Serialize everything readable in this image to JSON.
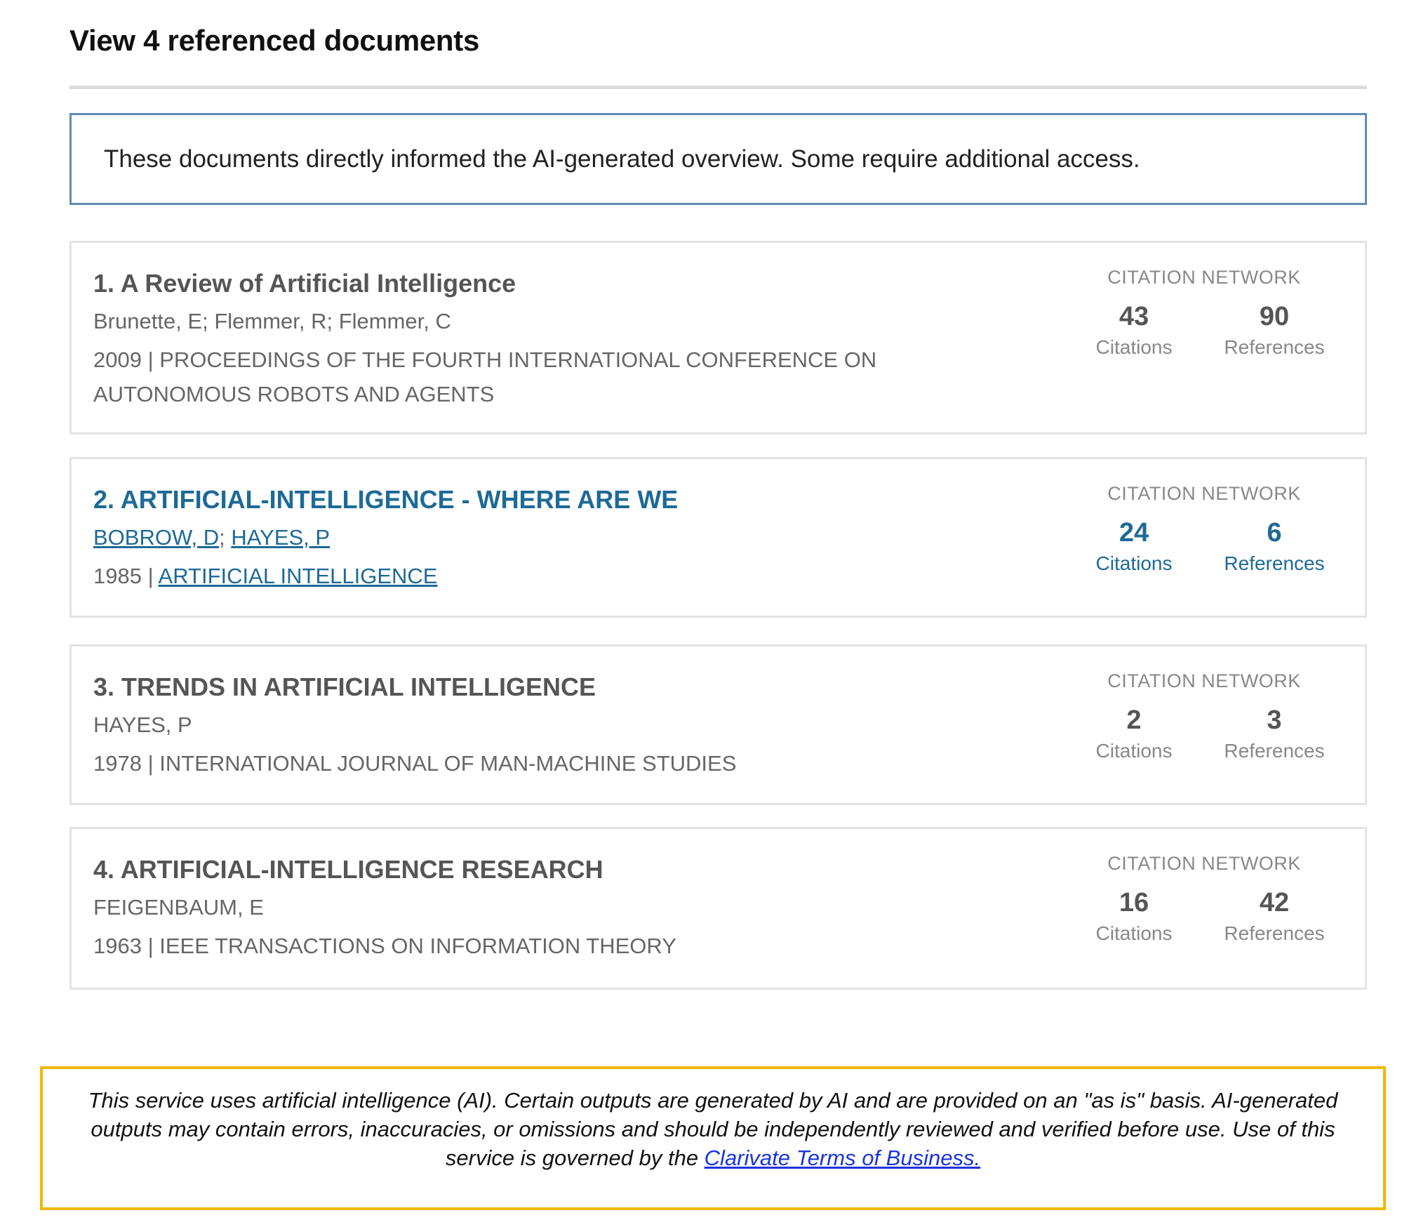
{
  "header": {
    "title": "View 4 referenced documents"
  },
  "notice": {
    "text": "These documents directly informed the AI-generated overview. Some require additional access."
  },
  "documents": [
    {
      "title": "1. A Review of Artificial Intelligence",
      "authors": "Brunette, E; Flemmer, R; Flemmer, C",
      "year": "2009",
      "separator": " | ",
      "source": "PROCEEDINGS OF THE FOURTH INTERNATIONAL CONFERENCE ON AUTONOMOUS ROBOTS AND AGENTS",
      "network_label": "CITATION NETWORK",
      "citations": "43",
      "citations_label": "Citations",
      "references": "90",
      "references_label": "References"
    },
    {
      "title": "2. ARTIFICIAL-INTELLIGENCE - WHERE ARE WE",
      "author_1": "BOBROW, D",
      "author_sep": "; ",
      "author_2": "HAYES, P",
      "year": "1985",
      "separator": " | ",
      "source": "ARTIFICIAL INTELLIGENCE",
      "network_label": "CITATION NETWORK",
      "citations": "24",
      "citations_label": "Citations",
      "references": "6",
      "references_label": "References"
    },
    {
      "title": "3. TRENDS IN ARTIFICIAL INTELLIGENCE",
      "authors": "HAYES, P",
      "year": "1978",
      "separator": " | ",
      "source": "INTERNATIONAL JOURNAL OF MAN-MACHINE STUDIES",
      "network_label": "CITATION NETWORK",
      "citations": "2",
      "citations_label": "Citations",
      "references": "3",
      "references_label": "References"
    },
    {
      "title": "4. ARTIFICIAL-INTELLIGENCE RESEARCH",
      "authors": "FEIGENBAUM, E",
      "year": "1963",
      "separator": " | ",
      "source": "IEEE TRANSACTIONS ON INFORMATION THEORY",
      "network_label": "CITATION NETWORK",
      "citations": "16",
      "citations_label": "Citations",
      "references": "42",
      "references_label": "References"
    }
  ],
  "disclaimer": {
    "text": "This service uses artificial intelligence (AI). Certain outputs are generated by AI and are provided on an \"as is\" basis. AI-generated outputs may contain errors, inaccuracies, or omissions and should be independently reviewed and verified before use. Use of this service is governed by the ",
    "link_text": "Clarivate Terms of Business."
  },
  "colors": {
    "link_blue": "#1d6a96",
    "notice_border": "#5e8db3",
    "disclaimer_border": "#f2b705",
    "terms_link": "#1a33e0"
  }
}
